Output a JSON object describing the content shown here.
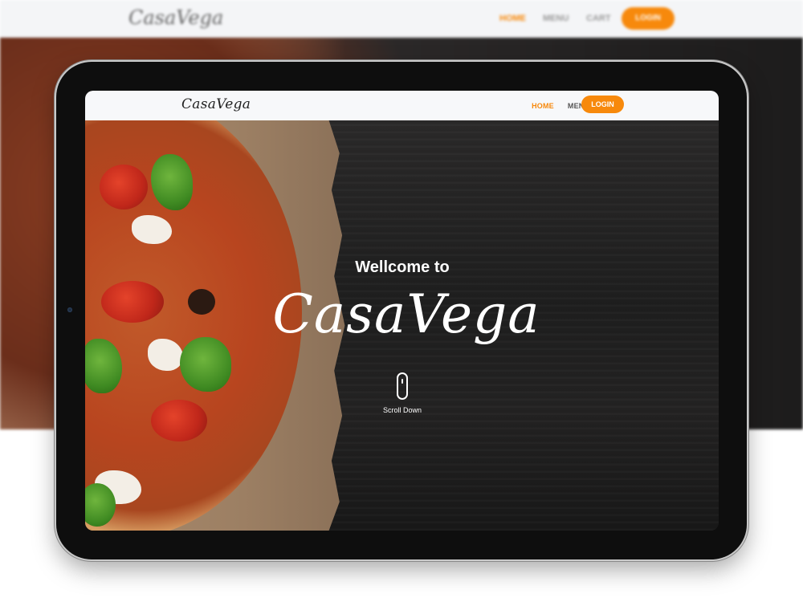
{
  "site": {
    "brand": "CasaVega",
    "accent_color": "#f7890c"
  },
  "nav": {
    "items": [
      {
        "label": "HOME",
        "active": true
      },
      {
        "label": "MENU",
        "active": false
      },
      {
        "label": "CART",
        "active": false
      }
    ],
    "login_label": "LOGIN"
  },
  "hero": {
    "welcome": "Wellcome to",
    "title": "CasaVega",
    "scroll_label": "Scroll Down",
    "scroll_icon": "mouse-icon"
  }
}
